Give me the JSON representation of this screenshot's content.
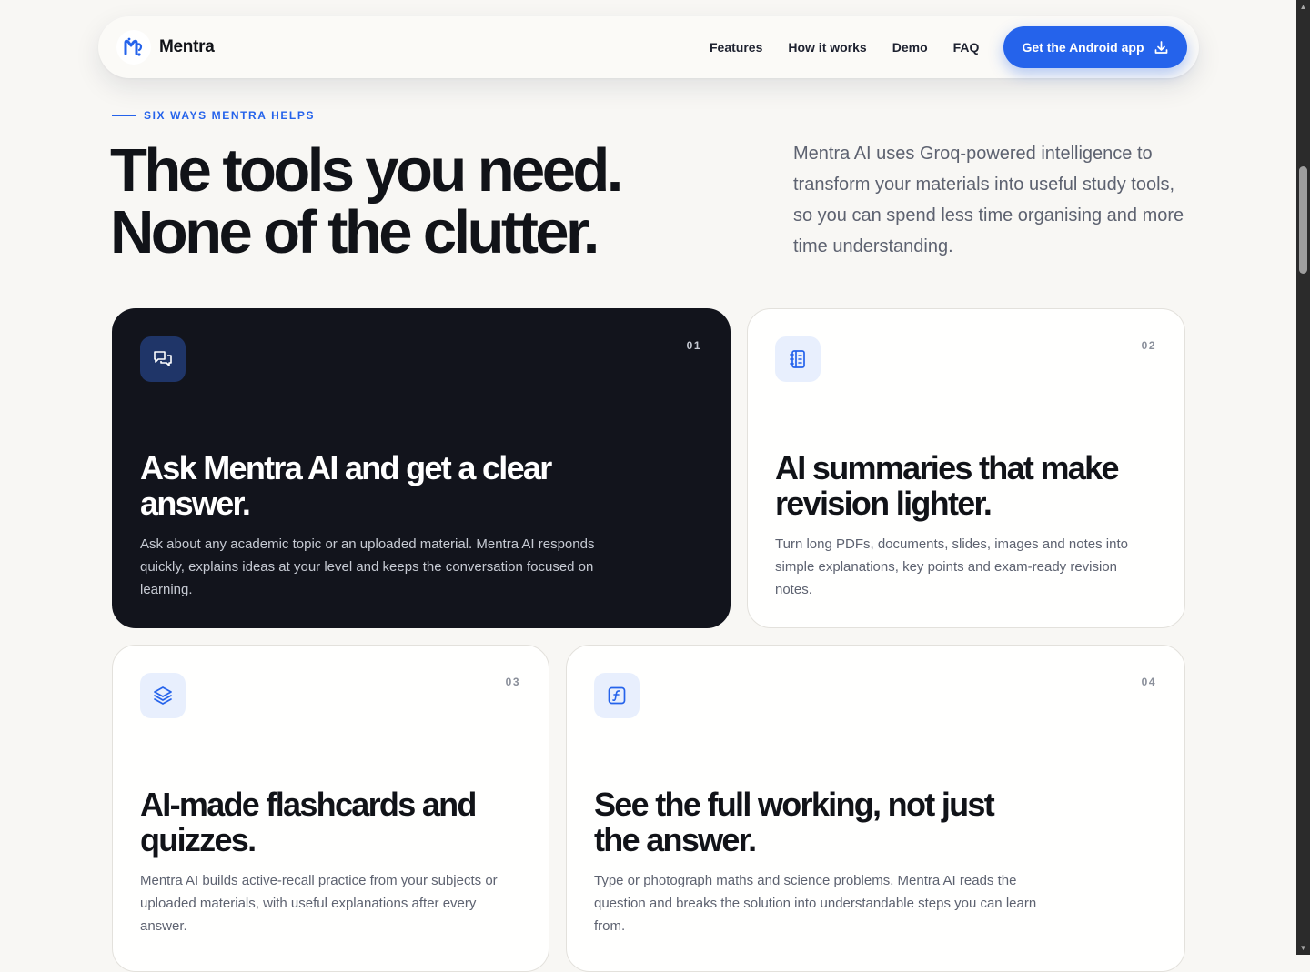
{
  "nav": {
    "brand": "Mentra",
    "links": [
      "Features",
      "How it works",
      "Demo",
      "FAQ"
    ],
    "cta_label": "Get the Android app"
  },
  "hero": {
    "eyebrow": "SIX WAYS MENTRA HELPS",
    "headline_line1": "The tools you need.",
    "headline_line2": "None of the clutter.",
    "intro": "Mentra AI uses Groq-powered intelligence to transform your materials into useful study tools, so you can spend less time organising and more time understanding."
  },
  "cards": [
    {
      "number": "01",
      "icon": "chat-bubbles-icon",
      "title": "Ask Mentra AI and get a clear answer.",
      "description": "Ask about any academic topic or an uploaded material. Mentra AI responds quickly, explains ideas at your level and keeps the conversation focused on learning."
    },
    {
      "number": "02",
      "icon": "notebook-icon",
      "title": "AI summaries that make revision lighter.",
      "description": "Turn long PDFs, documents, slides, images and notes into simple explanations, key points and exam-ready revision notes."
    },
    {
      "number": "03",
      "icon": "layers-icon",
      "title": "AI-made flashcards and quizzes.",
      "description": "Mentra AI builds active-recall practice from your subjects or uploaded materials, with useful explanations after every answer."
    },
    {
      "number": "04",
      "icon": "function-icon",
      "title": "See the full working, not just the answer.",
      "description": "Type or photograph maths and science problems. Mentra AI reads the question and breaks the solution into understandable steps you can learn from."
    }
  ],
  "colors": {
    "accent": "#2563eb",
    "dark_card": "#12141c",
    "background": "#f8f7f4"
  }
}
